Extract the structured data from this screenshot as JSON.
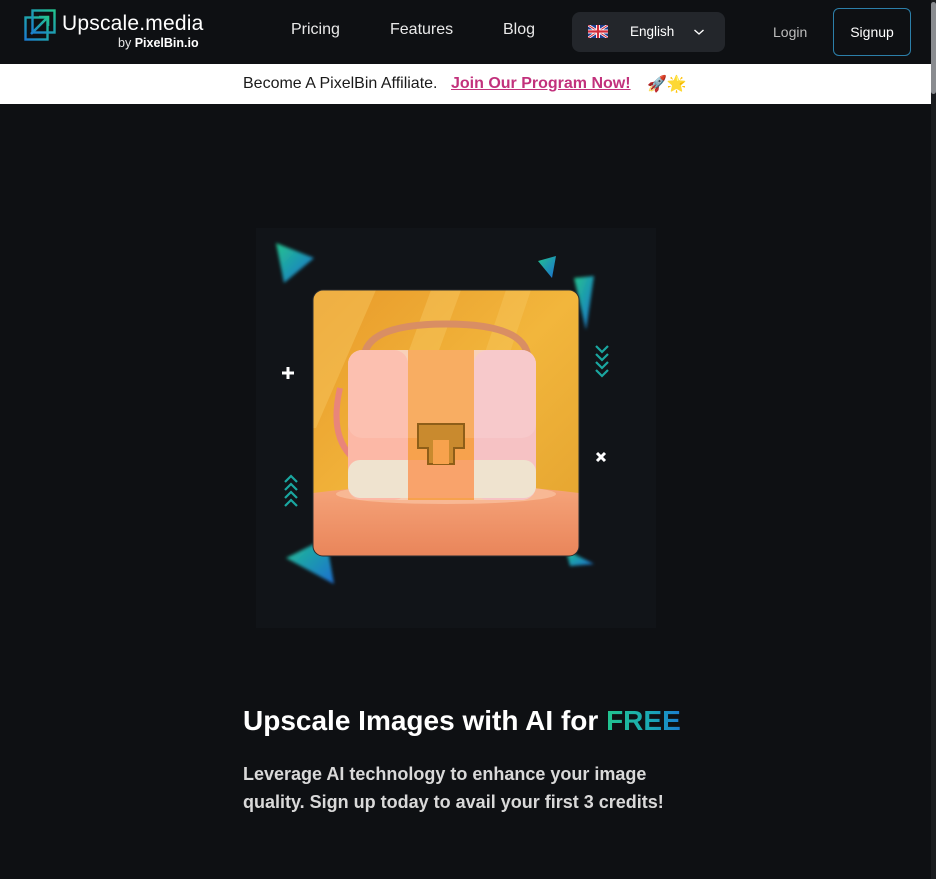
{
  "header": {
    "logo": {
      "name": "Upscale.media",
      "by": "by",
      "brand": "PixelBin.io",
      "icon": "upscale-arrow-icon"
    },
    "nav": [
      {
        "label": "Pricing"
      },
      {
        "label": "Features"
      },
      {
        "label": "Blog"
      }
    ],
    "language": {
      "label": "English",
      "flag": "uk-flag-icon",
      "icon": "chevron-down-icon"
    },
    "login_label": "Login",
    "signup_label": "Signup"
  },
  "banner": {
    "text": "Become A PixelBin Affiliate.",
    "link": "Join Our Program Now!",
    "emoji": "🚀🌟",
    "link_color": "#c2317c"
  },
  "hero": {
    "title_prefix": "Upscale Images with AI for ",
    "title_highlight": "FREE",
    "subtitle": "Leverage AI technology to enhance your image quality. Sign up today to avail your first 3 credits!",
    "image_subject": "handbag-photo",
    "accent_colors": [
      "#22c38e",
      "#1b7dd1"
    ]
  },
  "colors": {
    "background": "#0e1013",
    "signup_border": "#2c7fa9",
    "lang_bg": "#23262b"
  }
}
